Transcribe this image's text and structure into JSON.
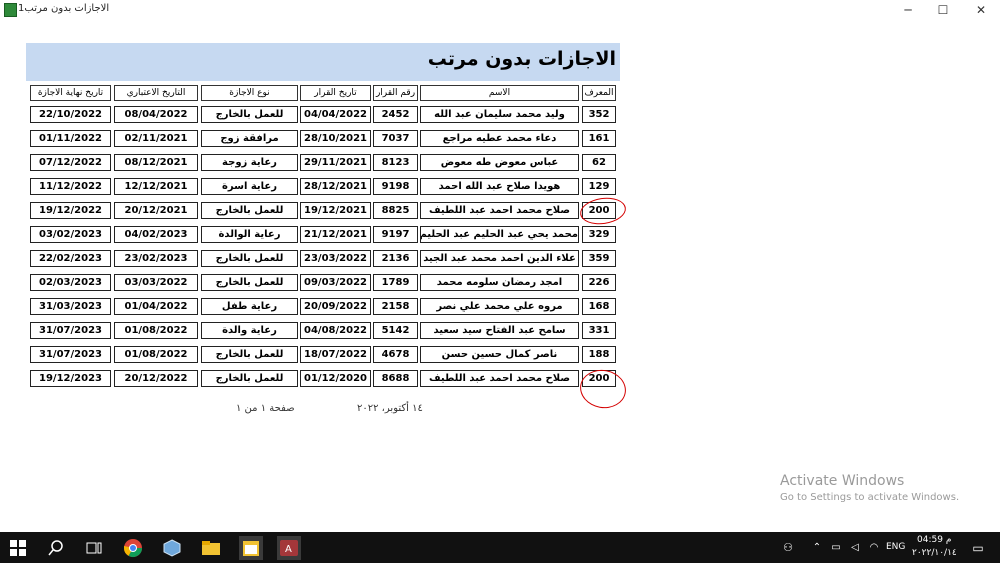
{
  "window": {
    "title": "الاجازات بدون مرتب1",
    "minimize": "─",
    "maximize": "☐",
    "close": "✕"
  },
  "report": {
    "title": "الاجازات بدون مرتب",
    "headers": {
      "id": "المعرف",
      "name": "الاسم",
      "decision_no": "رقم القرار",
      "decision_date": "تاريخ القرار",
      "leave_type": "نوع الاجازة",
      "effective_date": "التاريخ الاعتباري",
      "end_date": "تاريخ نهاية الاجازة"
    },
    "rows": [
      {
        "id": "352",
        "name": "وليد محمد سليمان عبد الله",
        "decision_no": "2452",
        "decision_date": "04/04/2022",
        "leave_type": "للعمل بالخارج",
        "effective_date": "08/04/2022",
        "end_date": "22/10/2022"
      },
      {
        "id": "161",
        "name": "دعاء محمد عطيه مراجع",
        "decision_no": "7037",
        "decision_date": "28/10/2021",
        "leave_type": "مرافقة زوج",
        "effective_date": "02/11/2021",
        "end_date": "01/11/2022"
      },
      {
        "id": "62",
        "name": "عباس معوض طه معوض",
        "decision_no": "8123",
        "decision_date": "29/11/2021",
        "leave_type": "رعاية زوجة",
        "effective_date": "08/12/2021",
        "end_date": "07/12/2022"
      },
      {
        "id": "129",
        "name": "هويدا صلاح عبد الله احمد",
        "decision_no": "9198",
        "decision_date": "28/12/2021",
        "leave_type": "رعاية اسرة",
        "effective_date": "12/12/2021",
        "end_date": "11/12/2022"
      },
      {
        "id": "200",
        "name": "صلاح محمد احمد عبد اللطيف",
        "decision_no": "8825",
        "decision_date": "19/12/2021",
        "leave_type": "للعمل بالخارج",
        "effective_date": "20/12/2021",
        "end_date": "19/12/2022"
      },
      {
        "id": "329",
        "name": "محمد يحي عبد الحليم عبد الحليم",
        "decision_no": "9197",
        "decision_date": "21/12/2021",
        "leave_type": "رعاية الوالدة",
        "effective_date": "04/02/2023",
        "end_date": "03/02/2023"
      },
      {
        "id": "359",
        "name": "علاء الدين احمد محمد عبد الجيد",
        "decision_no": "2136",
        "decision_date": "23/03/2022",
        "leave_type": "للعمل بالخارج",
        "effective_date": "23/02/2023",
        "end_date": "22/02/2023"
      },
      {
        "id": "226",
        "name": "امجد رمضان سلومه محمد",
        "decision_no": "1789",
        "decision_date": "09/03/2022",
        "leave_type": "للعمل بالخارج",
        "effective_date": "03/03/2022",
        "end_date": "02/03/2023"
      },
      {
        "id": "168",
        "name": "مروه علي محمد علي نصر",
        "decision_no": "2158",
        "decision_date": "20/09/2022",
        "leave_type": "رعاية طفل",
        "effective_date": "01/04/2022",
        "end_date": "31/03/2023"
      },
      {
        "id": "331",
        "name": "سامح عبد الفتاح سيد سعيد",
        "decision_no": "5142",
        "decision_date": "04/08/2022",
        "leave_type": "رعاية والدة",
        "effective_date": "01/08/2022",
        "end_date": "31/07/2023"
      },
      {
        "id": "188",
        "name": "ناصر كمال حسين حسن",
        "decision_no": "4678",
        "decision_date": "18/07/2022",
        "leave_type": "للعمل بالخارج",
        "effective_date": "01/08/2022",
        "end_date": "31/07/2023"
      },
      {
        "id": "200",
        "name": "صلاح محمد احمد عبد اللطيف",
        "decision_no": "8688",
        "decision_date": "01/12/2020",
        "leave_type": "للعمل بالخارج",
        "effective_date": "20/12/2022",
        "end_date": "19/12/2023"
      }
    ],
    "footer": {
      "date": "١٤ أكتوبر، ٢٠٢٢",
      "page": "صفحة ١ من ١"
    }
  },
  "activate": {
    "line1": "Activate Windows",
    "line2": "Go to Settings to activate Windows."
  },
  "taskbar": {
    "items": [
      "windows-start",
      "search",
      "task-view",
      "chrome",
      "virtualbox",
      "file-explorer",
      "calendar-app",
      "access"
    ],
    "lang": "ENG",
    "time": "04:59 م",
    "date": "٢٠٢٢/١٠/١٤"
  },
  "colors": {
    "banner": "#c6d9f1",
    "annotation": "#d40000",
    "taskbar": "#111111"
  }
}
